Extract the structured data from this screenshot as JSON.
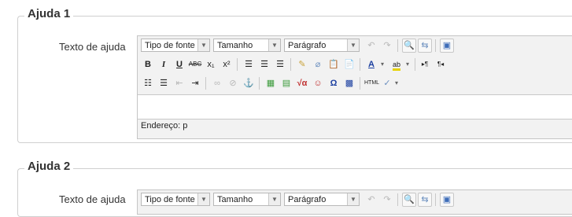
{
  "sections": [
    {
      "legend": "Ajuda 1",
      "field_label": "Texto de ajuda",
      "font_family_value": "Tipo de fonte",
      "font_size_value": "Tamanho",
      "format_value": "Parágrafo",
      "status_text": "Endereço: p"
    },
    {
      "legend": "Ajuda 2",
      "field_label": "Texto de ajuda",
      "font_family_value": "Tipo de fonte",
      "font_size_value": "Tamanho",
      "format_value": "Parágrafo"
    }
  ],
  "toolbar": {
    "bold_glyph": "B",
    "italic_glyph": "I",
    "underline_glyph": "U",
    "strike_glyph": "ABC",
    "subscript_glyph": "x₁",
    "superscript_glyph": "x²",
    "font_color_glyph": "A",
    "highlight_glyph": "ab",
    "omega_glyph": "Ω",
    "html_glyph": "HTML",
    "ltr_glyph": "▸¶",
    "rtl_glyph": "¶◂"
  },
  "colors": {
    "border": "#cfcfcf",
    "toolbar_bg": "#f2f2f2"
  }
}
